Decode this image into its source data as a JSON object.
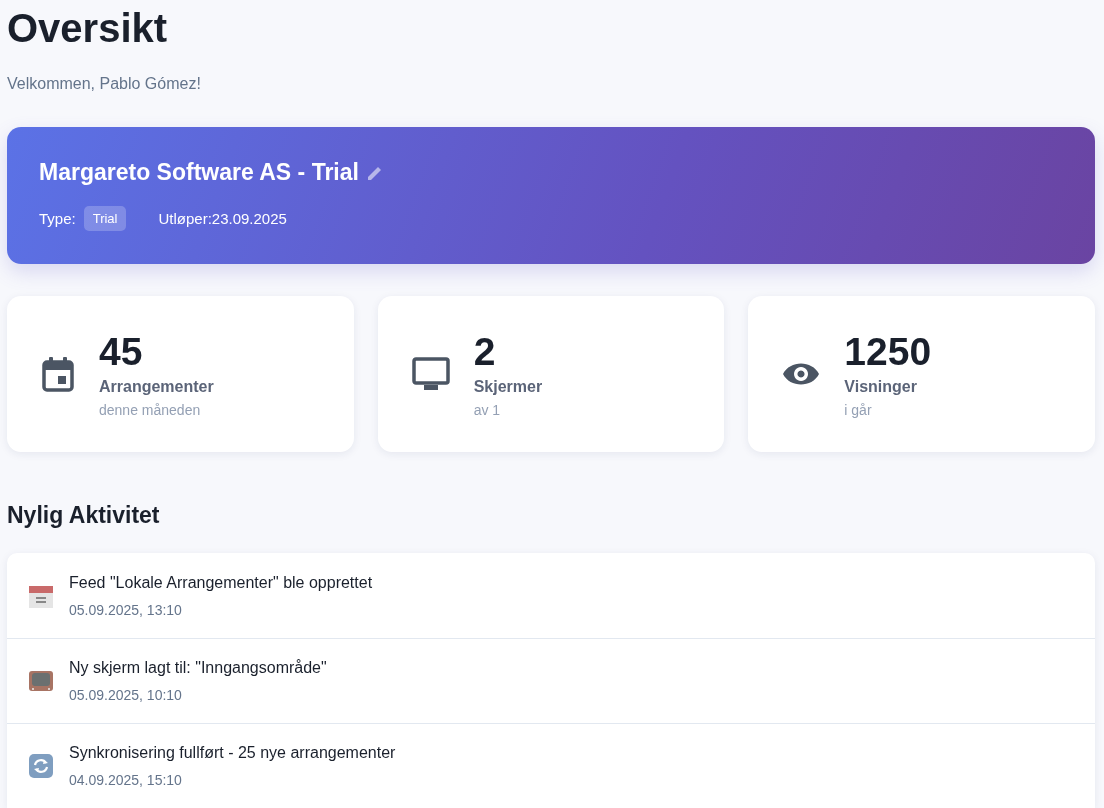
{
  "title": "Oversikt",
  "welcome": "Velkommen, Pablo Gómez!",
  "account": {
    "name": "Margareto Software AS - Trial",
    "type_label": "Type:",
    "type_badge": "Trial",
    "expires": "Utløper:23.09.2025"
  },
  "stats": [
    {
      "kind": "calendar",
      "value": "45",
      "label": "Arrangementer",
      "sub": "denne måneden"
    },
    {
      "kind": "monitor",
      "value": "2",
      "label": "Skjermer",
      "sub": "av 1"
    },
    {
      "kind": "eye",
      "value": "1250",
      "label": "Visninger",
      "sub": "i går"
    }
  ],
  "activity": {
    "heading": "Nylig Aktivitet",
    "items": [
      {
        "kind": "calendar",
        "text": "Feed \"Lokale Arrangementer\" ble opprettet",
        "time": "05.09.2025, 13:10"
      },
      {
        "kind": "tv",
        "text": "Ny skjerm lagt til: \"Inngangsområde\"",
        "time": "05.09.2025, 10:10"
      },
      {
        "kind": "sync",
        "text": "Synkronisering fullført - 25 nye arrangementer",
        "time": "04.09.2025, 15:10"
      }
    ]
  }
}
